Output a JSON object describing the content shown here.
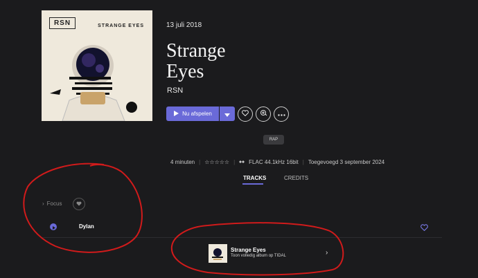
{
  "album": {
    "cover_logo": "RSN",
    "cover_title": "STRANGE EYES",
    "release_date": "13 juli 2018",
    "title_line1": "Strange",
    "title_line2": "Eyes",
    "artist": "RSN"
  },
  "actions": {
    "play_label": "Nu afspelen",
    "play_icon": "play-icon",
    "dropdown_icon": "chevron-down-icon",
    "favorite_icon": "heart-icon",
    "playlist_add_icon": "add-to-playlist-icon",
    "more_icon": "more-icon"
  },
  "genre": "RAP",
  "info": {
    "duration": "4 minuten",
    "rating": "☆☆☆☆☆",
    "quality": "FLAC 44.1kHz 16bit",
    "added": "Toegevoegd 3 september 2024"
  },
  "tabs": [
    {
      "label": "TRACKS",
      "active": true
    },
    {
      "label": "CREDITS",
      "active": false
    }
  ],
  "focus": {
    "chevron": "›",
    "label": "Focus"
  },
  "tracks": [
    {
      "name": "Dylan"
    }
  ],
  "tidal_card": {
    "title": "Strange Eyes",
    "subtitle": "Toon volledig album op TIDAL",
    "chevron": "›"
  },
  "colors": {
    "background": "#1b1b1d",
    "accent": "#6a6ad8",
    "annotation": "#d11b1b"
  }
}
